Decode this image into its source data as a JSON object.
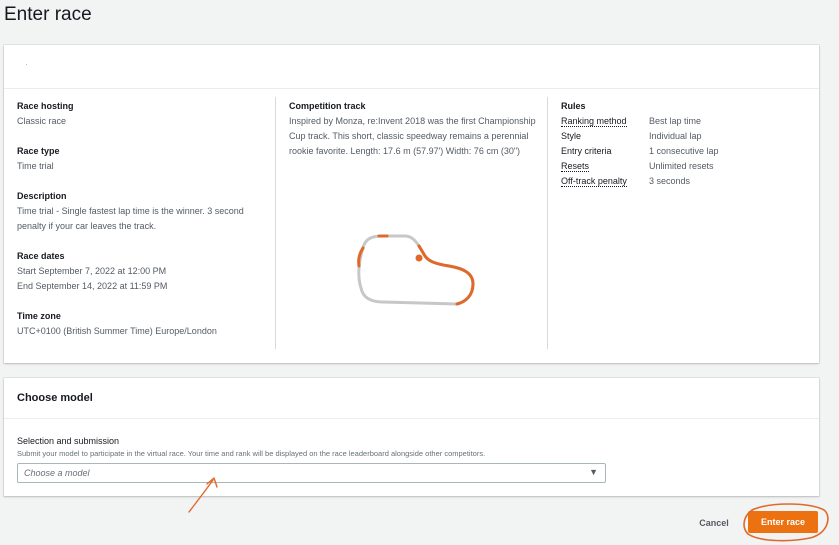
{
  "page": {
    "title": "Enter race"
  },
  "race": {
    "hosting": {
      "label": "Race hosting",
      "value": "Classic race"
    },
    "type": {
      "label": "Race type",
      "value": "Time trial"
    },
    "description": {
      "label": "Description",
      "value": "Time trial - Single fastest lap time is the winner. 3 second penalty if your car leaves the track."
    },
    "dates": {
      "label": "Race dates",
      "start": "Start September 7, 2022 at 12:00 PM",
      "end": "End September 14, 2022 at 11:59 PM"
    },
    "timezone": {
      "label": "Time zone",
      "value": "UTC+0100 (British Summer Time) Europe/London"
    }
  },
  "track": {
    "label": "Competition track",
    "description": "Inspired by Monza, re:Invent 2018 was the first Championship Cup track. This short, classic speedway remains a perennial rookie favorite. Length: 17.6 m (57.97') Width: 76 cm (30\")"
  },
  "rules": {
    "label": "Rules",
    "items": [
      {
        "key": "Ranking method",
        "value": "Best lap time",
        "dotted": true
      },
      {
        "key": "Style",
        "value": "Individual lap",
        "dotted": false
      },
      {
        "key": "Entry criteria",
        "value": "1 consecutive lap",
        "dotted": false
      },
      {
        "key": "Resets",
        "value": "Unlimited resets",
        "dotted": true
      },
      {
        "key": "Off-track penalty",
        "value": "3 seconds",
        "dotted": true
      }
    ]
  },
  "model": {
    "title": "Choose model",
    "selection_label": "Selection and submission",
    "selection_desc": "Submit your model to participate in the virtual race. Your time and rank will be displayed on the race leaderboard alongside other competitors.",
    "placeholder": "Choose a model"
  },
  "actions": {
    "cancel": "Cancel",
    "enter": "Enter race"
  },
  "colors": {
    "accent": "#ec7211",
    "annotation": "#e0692a"
  }
}
